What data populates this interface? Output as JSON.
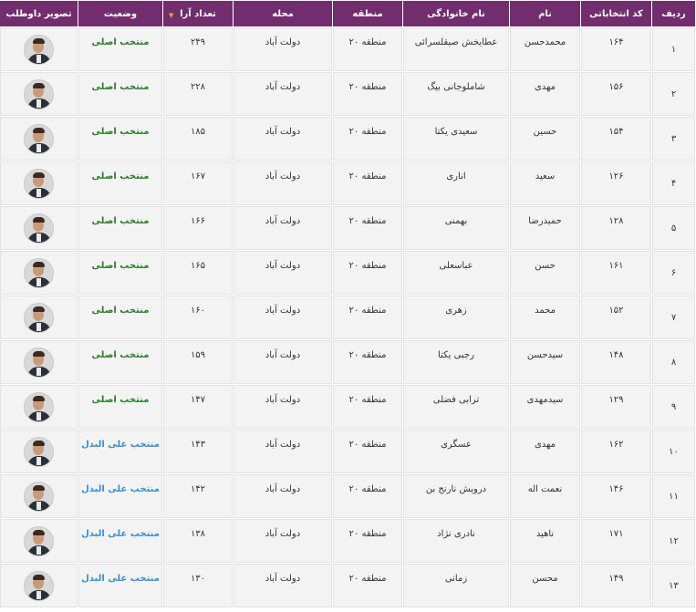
{
  "headers": {
    "row": "ردیف",
    "code": "کد انتخاباتی",
    "name": "نام",
    "family": "نام خانوادگی",
    "region": "منطقه",
    "area": "محله",
    "votes": "تعداد آرا",
    "status": "وضعیت",
    "photo": "تصویر داوطلب"
  },
  "sort_indicator": "▼",
  "colors": {
    "header_bg": "#722d6e",
    "status_main": "#2e7d2e",
    "status_alt": "#3a8fd4"
  },
  "rows": [
    {
      "row": "۱",
      "code": "۱۶۴",
      "name": "محمدحسن",
      "family": "عطایخش صیقلسرائی",
      "region": "منطقه ۲۰",
      "area": "دولت آباد",
      "votes": "۲۴۹",
      "status": "منتخب اصلی",
      "status_type": "main"
    },
    {
      "row": "۲",
      "code": "۱۵۶",
      "name": "مهدی",
      "family": "شاملوجانی بیگ",
      "region": "منطقه ۲۰",
      "area": "دولت آباد",
      "votes": "۲۲۸",
      "status": "منتخب اصلی",
      "status_type": "main"
    },
    {
      "row": "۳",
      "code": "۱۵۴",
      "name": "حسین",
      "family": "سعیدی یکتا",
      "region": "منطقه ۲۰",
      "area": "دولت آباد",
      "votes": "۱۸۵",
      "status": "منتخب اصلی",
      "status_type": "main"
    },
    {
      "row": "۴",
      "code": "۱۲۶",
      "name": "سعید",
      "family": "اناری",
      "region": "منطقه ۲۰",
      "area": "دولت آباد",
      "votes": "۱۶۷",
      "status": "منتخب اصلی",
      "status_type": "main"
    },
    {
      "row": "۵",
      "code": "۱۲۸",
      "name": "حمیدرضا",
      "family": "بهمنی",
      "region": "منطقه ۲۰",
      "area": "دولت آباد",
      "votes": "۱۶۶",
      "status": "منتخب اصلی",
      "status_type": "main"
    },
    {
      "row": "۶",
      "code": "۱۶۱",
      "name": "حسن",
      "family": "عباسعلی",
      "region": "منطقه ۲۰",
      "area": "دولت آباد",
      "votes": "۱۶۵",
      "status": "منتخب اصلی",
      "status_type": "main"
    },
    {
      "row": "۷",
      "code": "۱۵۲",
      "name": "محمد",
      "family": "زهری",
      "region": "منطقه ۲۰",
      "area": "دولت آباد",
      "votes": "۱۶۰",
      "status": "منتخب اصلی",
      "status_type": "main"
    },
    {
      "row": "۸",
      "code": "۱۴۸",
      "name": "سیدحسن",
      "family": "رجبی یکتا",
      "region": "منطقه ۲۰",
      "area": "دولت آباد",
      "votes": "۱۵۹",
      "status": "منتخب اصلی",
      "status_type": "main"
    },
    {
      "row": "۹",
      "code": "۱۲۹",
      "name": "سیدمهدی",
      "family": "ترابی فضلی",
      "region": "منطقه ۲۰",
      "area": "دولت آباد",
      "votes": "۱۴۷",
      "status": "منتخب اصلی",
      "status_type": "main"
    },
    {
      "row": "۱۰",
      "code": "۱۶۲",
      "name": "مهدی",
      "family": "عسگری",
      "region": "منطقه ۲۰",
      "area": "دولت آباد",
      "votes": "۱۴۳",
      "status": "منتخب علی البدل",
      "status_type": "alt"
    },
    {
      "row": "۱۱",
      "code": "۱۴۶",
      "name": "نعمت اله",
      "family": "درویش نارنج بن",
      "region": "منطقه ۲۰",
      "area": "دولت آباد",
      "votes": "۱۴۲",
      "status": "منتخب علی البدل",
      "status_type": "alt"
    },
    {
      "row": "۱۲",
      "code": "۱۷۱",
      "name": "ناهید",
      "family": "نادری نژاد",
      "region": "منطقه ۲۰",
      "area": "دولت آباد",
      "votes": "۱۳۸",
      "status": "منتخب علی البدل",
      "status_type": "alt"
    },
    {
      "row": "۱۳",
      "code": "۱۴۹",
      "name": "محسن",
      "family": "زمانی",
      "region": "منطقه ۲۰",
      "area": "دولت آباد",
      "votes": "۱۳۰",
      "status": "منتخب علی البدل",
      "status_type": "alt"
    }
  ]
}
